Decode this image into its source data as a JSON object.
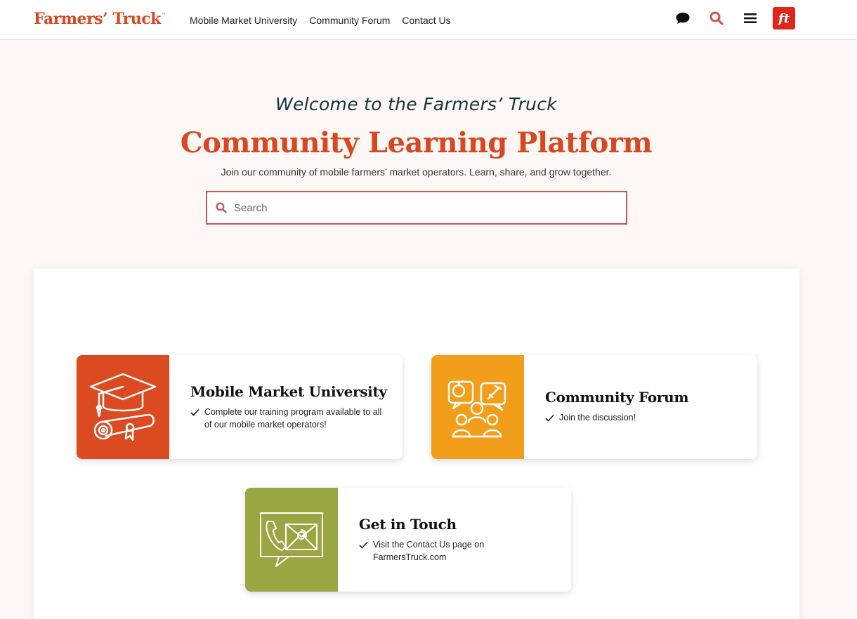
{
  "header": {
    "logo_text": "Farmers’ Truck",
    "logo_tm": "™",
    "nav": [
      {
        "label": "Mobile Market University"
      },
      {
        "label": "Community Forum"
      },
      {
        "label": "Contact Us"
      }
    ],
    "icons": [
      "chat-icon",
      "search-icon",
      "menu-icon",
      "ft-badge"
    ],
    "badge_text": "ft"
  },
  "hero": {
    "welcome": "Welcome to the Farmers’ Truck",
    "title": "Community Learning Platform",
    "subtitle": "Join our community of mobile farmers’ market operators. Learn, share, and grow together.",
    "search_placeholder": "Search"
  },
  "cards": [
    {
      "title": "Mobile Market University",
      "text": "Complete our training program available to all of our mobile market operators!",
      "icon": "graduation-cap-diploma-icon",
      "color": "#dc4a21"
    },
    {
      "title": "Community Forum",
      "text": "Join the discussion!",
      "icon": "community-discussion-icon",
      "color": "#f39e1a"
    },
    {
      "title": "Get in Touch",
      "text": "Visit the Contact Us page on FarmersTruck.com",
      "icon": "phone-mail-icon",
      "color": "#99a642"
    }
  ],
  "colors": {
    "brand_orange": "#d9461f",
    "background": "#fdf8f5",
    "search_border": "#c9585a",
    "badge_red": "#e0251b"
  }
}
